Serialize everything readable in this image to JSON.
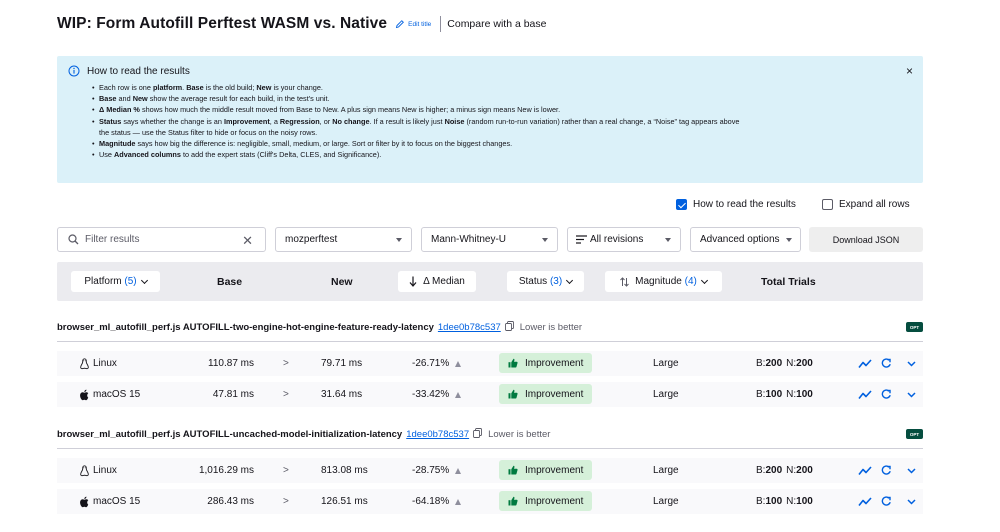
{
  "header": {
    "title": "WIP: Form Autofill Perftest WASM vs. Native",
    "edit_title": "Edit title",
    "compare_link": "Compare with a base"
  },
  "info": {
    "title": "How to read the results",
    "close": "×",
    "items": [
      {
        "parts": [
          {
            "t": "Each row is one "
          },
          {
            "b": "platform"
          },
          {
            "t": ". "
          },
          {
            "b": "Base"
          },
          {
            "t": " is the old build; "
          },
          {
            "b": "New"
          },
          {
            "t": " is your change."
          }
        ]
      },
      {
        "parts": [
          {
            "b": "Base"
          },
          {
            "t": " and "
          },
          {
            "b": "New"
          },
          {
            "t": " show the average result for each build, in the test's unit."
          }
        ]
      },
      {
        "parts": [
          {
            "b": "Δ Median %"
          },
          {
            "t": " shows how much the middle result moved from Base to New. A plus sign means New is higher; a minus sign means New is lower."
          }
        ]
      },
      {
        "parts": [
          {
            "b": "Status"
          },
          {
            "t": " says whether the change is an "
          },
          {
            "b": "Improvement"
          },
          {
            "t": ", a "
          },
          {
            "b": "Regression"
          },
          {
            "t": ", or "
          },
          {
            "b": "No change"
          },
          {
            "t": ". If a result is likely just "
          },
          {
            "b": "Noise"
          },
          {
            "t": " (random run-to-run variation) rather than a real change, a “Noise” tag appears above"
          }
        ]
      },
      {
        "cont": true,
        "parts": [
          {
            "t": "the status — use the Status filter to hide or focus on the noisy rows."
          }
        ]
      },
      {
        "parts": [
          {
            "b": "Magnitude"
          },
          {
            "t": " says how big the difference is: negligible, small, medium, or large. Sort or filter by it to focus on the biggest changes."
          }
        ]
      },
      {
        "parts": [
          {
            "t": "Use "
          },
          {
            "b": "Advanced columns"
          },
          {
            "t": " to add the expert stats (Cliff's Delta, CLES, and Significance)."
          }
        ]
      }
    ]
  },
  "toggles": {
    "how_to_read": "How to read the results",
    "expand_all": "Expand all rows"
  },
  "filters": {
    "search_placeholder": "Filter results",
    "framework": "mozperftest",
    "test": "Mann-Whitney-U",
    "revisions": "All revisions",
    "advanced": "Advanced options",
    "download": "Download JSON"
  },
  "columns": {
    "platform": "Platform",
    "platform_count": "(5)",
    "base": "Base",
    "new": "New",
    "delta": "Δ Median",
    "status": "Status",
    "status_count": "(3)",
    "magnitude": "Magnitude",
    "magnitude_count": "(4)",
    "trials": "Total Trials"
  },
  "groups": [
    {
      "name": "browser_ml_autofill_perf.js AUTOFILL-two-engine-hot-engine-feature-ready-latency",
      "revision": "1dee0b78c537",
      "direction": "Lower is better",
      "badge": "OPT",
      "rows": [
        {
          "platform": "Linux",
          "os_icon": "linux-icon",
          "base": "110.87 ms",
          "cmp": ">",
          "new": "79.71 ms",
          "delta": "-26.71%",
          "status": "Improvement",
          "magnitude": "Large",
          "b_label": "B:",
          "b": "200",
          "n_label": "N:",
          "n": "200"
        },
        {
          "platform": "macOS 15",
          "os_icon": "apple-icon",
          "base": "47.81 ms",
          "cmp": ">",
          "new": "31.64 ms",
          "delta": "-33.42%",
          "status": "Improvement",
          "magnitude": "Large",
          "b_label": "B:",
          "b": "100",
          "n_label": "N:",
          "n": "100"
        }
      ]
    },
    {
      "name": "browser_ml_autofill_perf.js AUTOFILL-uncached-model-initialization-latency",
      "revision": "1dee0b78c537",
      "direction": "Lower is better",
      "badge": "OPT",
      "rows": [
        {
          "platform": "Linux",
          "os_icon": "linux-icon",
          "base": "1,016.29 ms",
          "cmp": ">",
          "new": "813.08 ms",
          "delta": "-28.75%",
          "status": "Improvement",
          "magnitude": "Large",
          "b_label": "B:",
          "b": "200",
          "n_label": "N:",
          "n": "200"
        },
        {
          "platform": "macOS 15",
          "os_icon": "apple-icon",
          "base": "286.43 ms",
          "cmp": ">",
          "new": "126.51 ms",
          "delta": "-64.18%",
          "status": "Improvement",
          "magnitude": "Large",
          "b_label": "B:",
          "b": "100",
          "n_label": "N:",
          "n": "100"
        }
      ]
    }
  ],
  "colors": {
    "accent": "#0060df",
    "info_bg": "#dbf1f9",
    "improvement_bg": "#d5f0d9",
    "improvement_icon": "#017a40",
    "badge_bg": "#054d3f"
  }
}
